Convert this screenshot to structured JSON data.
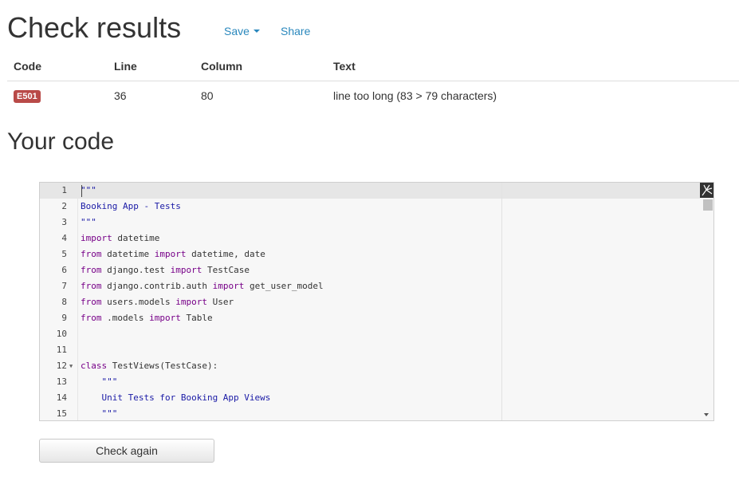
{
  "header": {
    "title": "Check results",
    "save_label": "Save",
    "share_label": "Share"
  },
  "results": {
    "columns": [
      "Code",
      "Line",
      "Column",
      "Text"
    ],
    "rows": [
      {
        "code": "E501",
        "line": "36",
        "column": "80",
        "text": "line too long (83 > 79 characters)"
      }
    ]
  },
  "code_section": {
    "title": "Your code",
    "lines": [
      {
        "n": "1",
        "text": "\"\"\""
      },
      {
        "n": "2",
        "text": "Booking App - Tests"
      },
      {
        "n": "3",
        "text": "\"\"\""
      },
      {
        "n": "4",
        "kw": "import",
        "rest": " datetime"
      },
      {
        "n": "5",
        "kw": "from",
        "mid": " datetime ",
        "kw2": "import",
        "rest": " datetime, date"
      },
      {
        "n": "6",
        "kw": "from",
        "mid": " django.test ",
        "kw2": "import",
        "rest": " TestCase"
      },
      {
        "n": "7",
        "kw": "from",
        "mid": " django.contrib.auth ",
        "kw2": "import",
        "rest": " get_user_model"
      },
      {
        "n": "8",
        "kw": "from",
        "mid": " users.models ",
        "kw2": "import",
        "rest": " User"
      },
      {
        "n": "9",
        "kw": "from",
        "mid": " .models ",
        "kw2": "import",
        "rest": " Table"
      },
      {
        "n": "10",
        "text": ""
      },
      {
        "n": "11",
        "text": ""
      },
      {
        "n": "12",
        "kw": "class",
        "rest": " TestViews(TestCase):"
      },
      {
        "n": "13",
        "text": "    \"\"\""
      },
      {
        "n": "14",
        "text": "    Unit Tests for Booking App Views"
      },
      {
        "n": "15",
        "text": "    \"\"\""
      }
    ]
  },
  "actions": {
    "check_again_label": "Check again"
  },
  "colors": {
    "link": "#2a88bd",
    "error_badge": "#b94a48",
    "keyword": "#770088",
    "string": "#1a1aa6"
  }
}
